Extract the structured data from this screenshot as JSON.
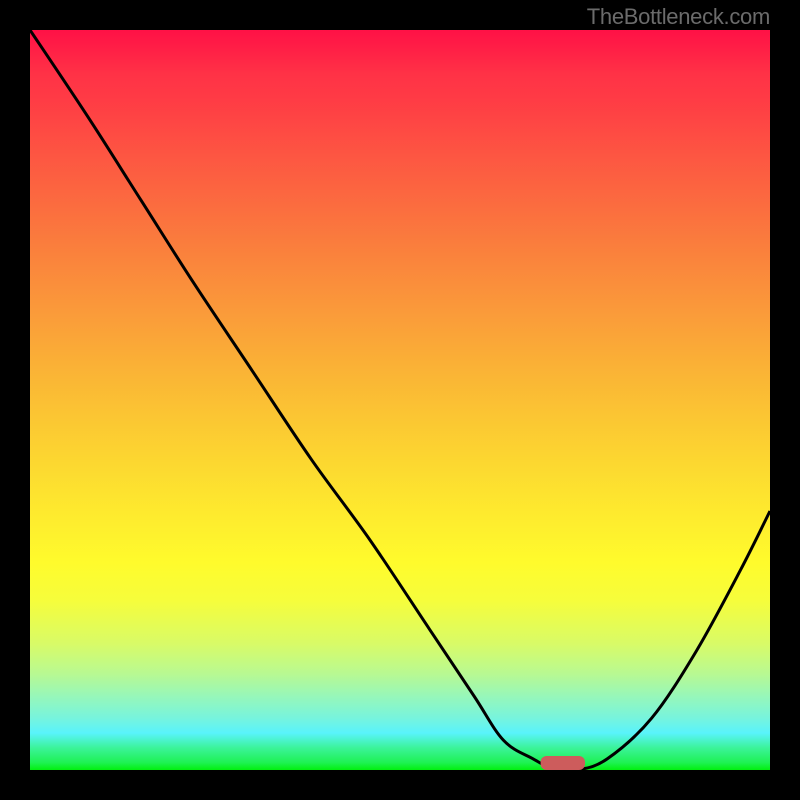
{
  "watermark": "TheBottleneck.com",
  "chart_data": {
    "type": "line",
    "title": "",
    "xlabel": "",
    "ylabel": "",
    "xlim": [
      0,
      1
    ],
    "ylim": [
      0,
      1
    ],
    "curve": {
      "x": [
        0.0,
        0.08,
        0.15,
        0.22,
        0.3,
        0.38,
        0.46,
        0.54,
        0.6,
        0.64,
        0.68,
        0.71,
        0.74,
        0.78,
        0.84,
        0.9,
        0.96,
        1.0
      ],
      "y": [
        1.0,
        0.88,
        0.77,
        0.66,
        0.54,
        0.42,
        0.31,
        0.19,
        0.1,
        0.04,
        0.015,
        0.0,
        0.0,
        0.015,
        0.07,
        0.16,
        0.27,
        0.35
      ]
    },
    "optimum_marker": {
      "x0": 0.69,
      "x1": 0.75,
      "color": "#cd5c5c"
    },
    "gradient_stops": [
      {
        "pos": 0.0,
        "color": "#ff1146"
      },
      {
        "pos": 0.5,
        "color": "#fbc832"
      },
      {
        "pos": 0.75,
        "color": "#fffb2c"
      },
      {
        "pos": 1.0,
        "color": "#01f00f"
      }
    ]
  }
}
